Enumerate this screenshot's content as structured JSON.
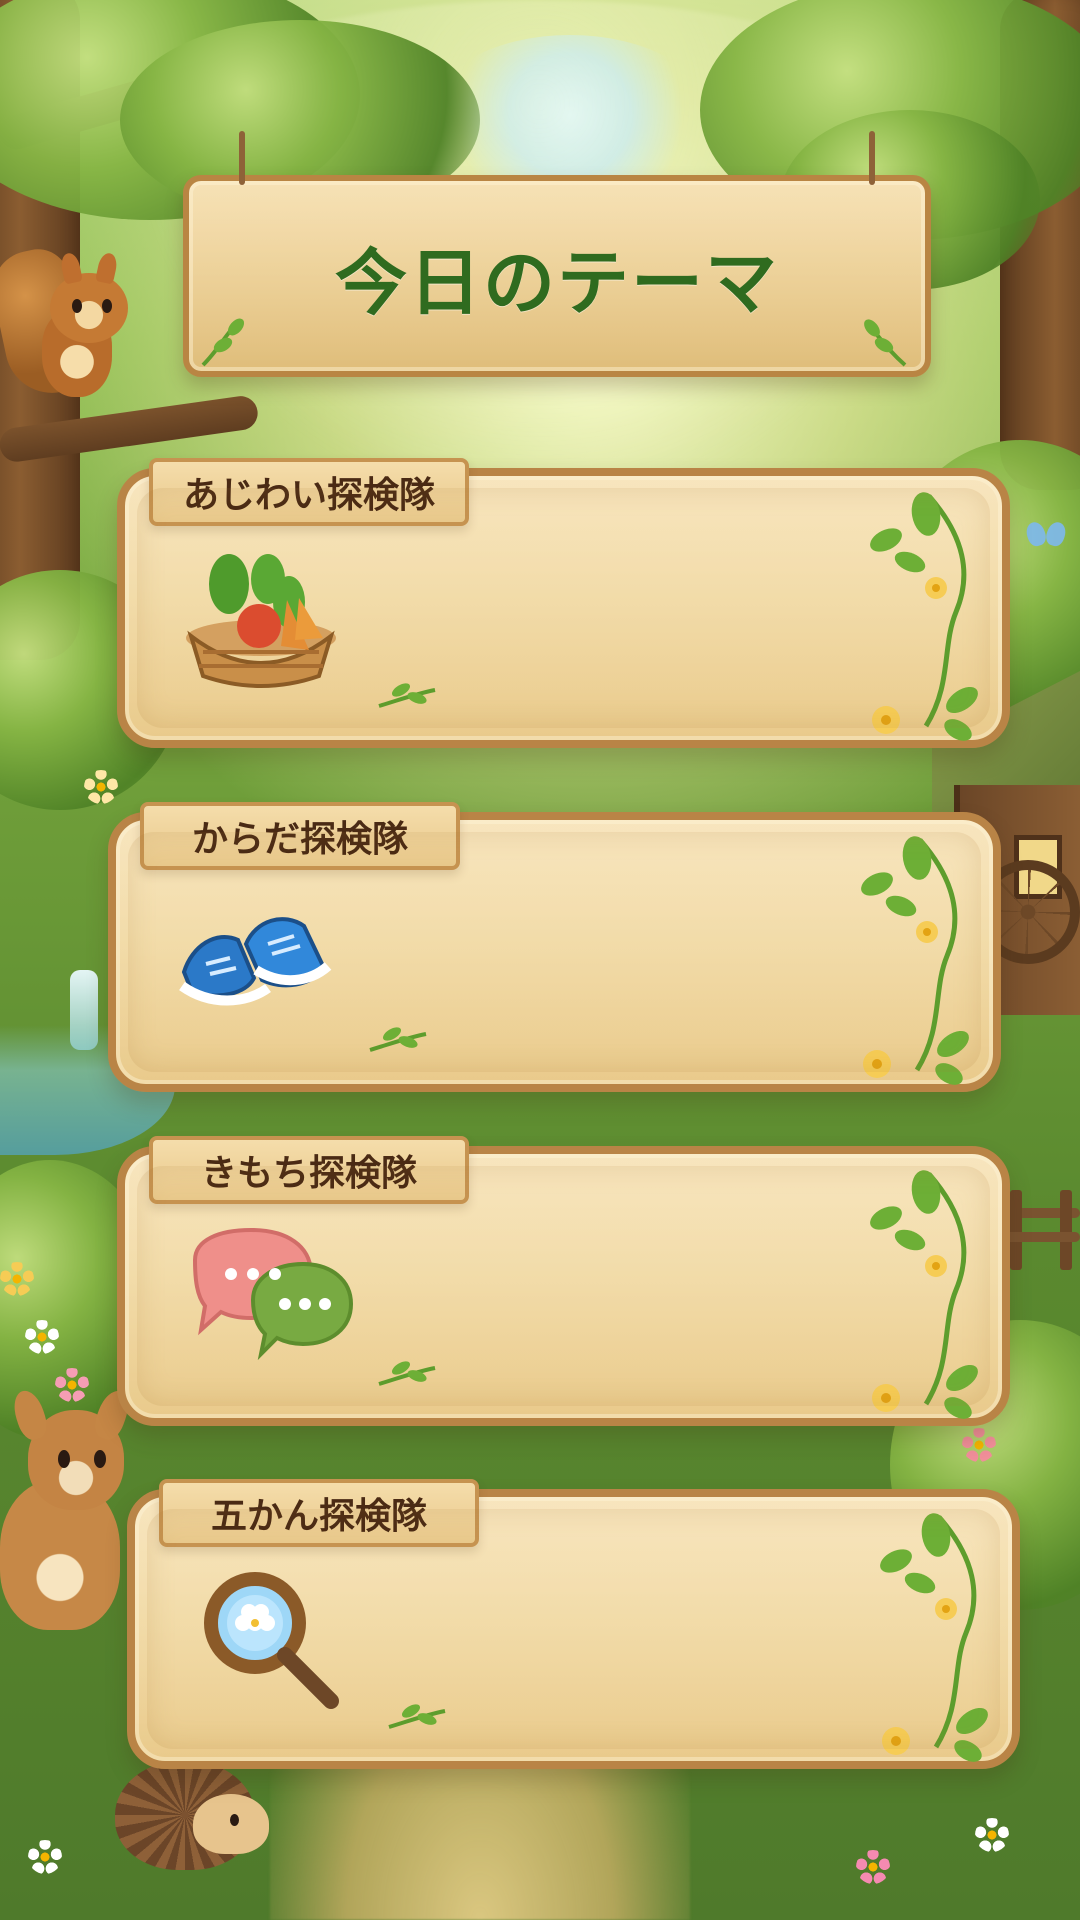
{
  "screen": {
    "title": "今日のテーマ"
  },
  "themes": [
    {
      "label": "あじわい探検隊",
      "icon": "vegetable-basket-icon"
    },
    {
      "label": "からだ探検隊",
      "icon": "shoes-icon"
    },
    {
      "label": "きもち探検隊",
      "icon": "chat-bubbles-icon"
    },
    {
      "label": "五かん探検隊",
      "icon": "magnifying-glass-icon"
    }
  ],
  "colors": {
    "title_text": "#2f6b1f",
    "label_text": "#4a2a14",
    "panel_fill": "#f2d9a3",
    "panel_border": "#b98446",
    "leaf_green": "#5d9d2d",
    "flower_yellow": "#f6cc55",
    "chat_red": "#ef8f8a",
    "chat_green": "#78aa42",
    "shoe_blue": "#2b79c8",
    "lens_blue": "#9ed7f7"
  }
}
